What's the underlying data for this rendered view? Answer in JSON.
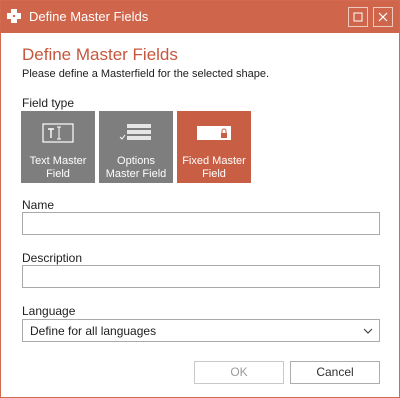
{
  "window": {
    "title": "Define Master Fields"
  },
  "dialog": {
    "heading": "Define Master Fields",
    "subtitle": "Please define a Masterfield for the selected shape."
  },
  "field_type": {
    "label": "Field type",
    "tiles": [
      {
        "label": "Text Master Field",
        "icon": "text-field-icon",
        "selected": false
      },
      {
        "label": "Options Master Field",
        "icon": "options-list-icon",
        "selected": false
      },
      {
        "label": "Fixed Master Field",
        "icon": "locked-field-icon",
        "selected": true
      }
    ]
  },
  "name": {
    "label": "Name",
    "value": ""
  },
  "description": {
    "label": "Description",
    "value": ""
  },
  "language": {
    "label": "Language",
    "selected": "Define for all languages"
  },
  "buttons": {
    "ok": "OK",
    "cancel": "Cancel"
  },
  "colors": {
    "accent": "#cf664b",
    "heading": "#c4573c",
    "tile_gray": "#7e7e7e",
    "tile_selected": "#c85f45"
  }
}
